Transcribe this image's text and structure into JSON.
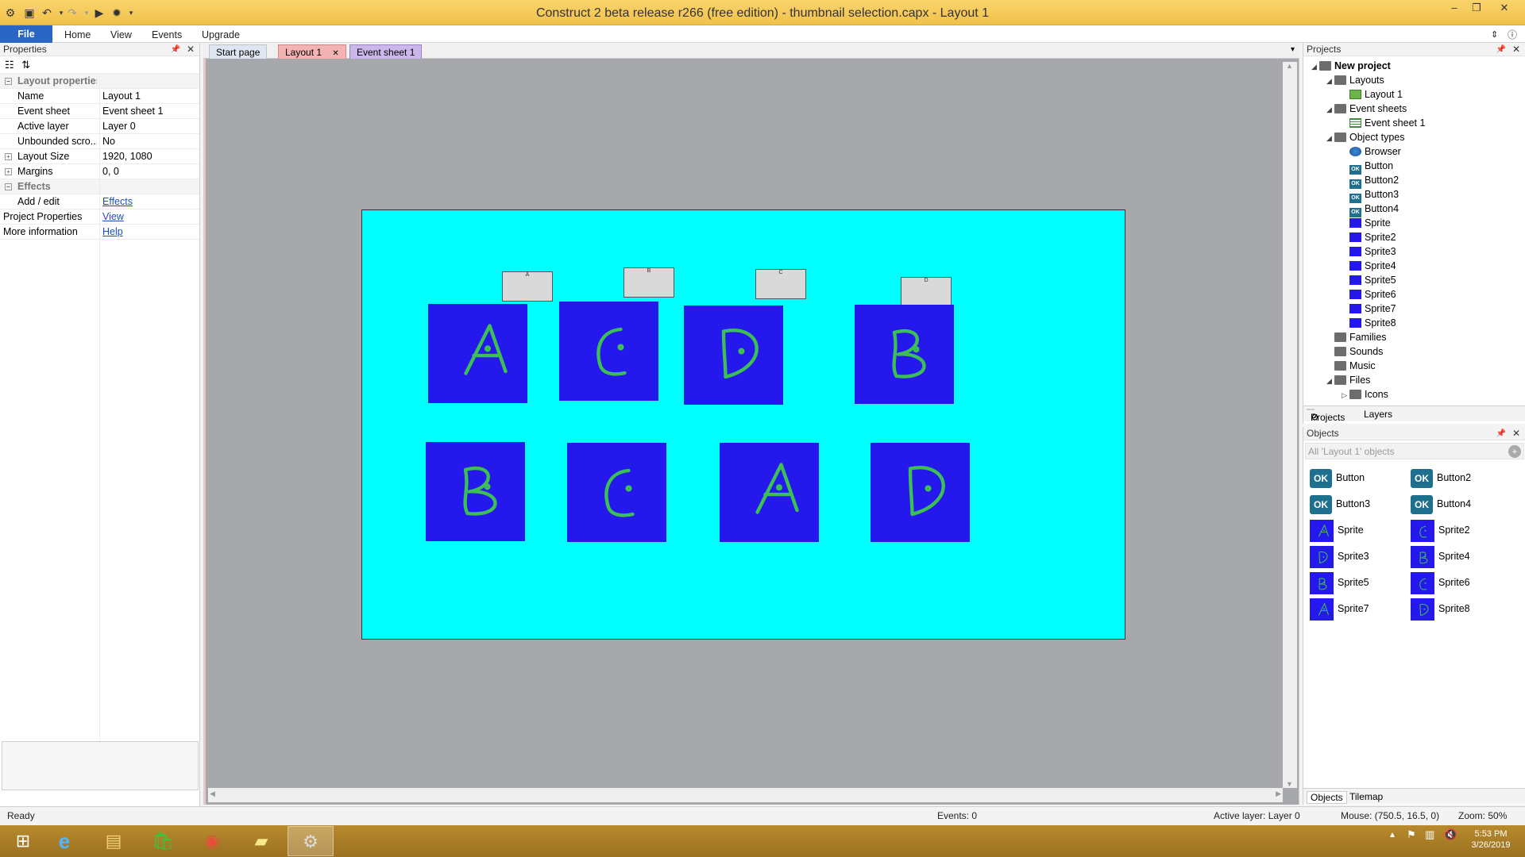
{
  "window": {
    "title": "Construct 2 beta release r266  (free edition) - thumbnail selection.capx - Layout 1"
  },
  "menu": [
    "File",
    "Home",
    "View",
    "Events",
    "Upgrade"
  ],
  "properties": {
    "header": "Properties",
    "rows": [
      {
        "type": "cat",
        "key": "Layout properties",
        "expander": "−"
      },
      {
        "key": "Name",
        "value": "Layout 1"
      },
      {
        "key": "Event sheet",
        "value": "Event sheet 1"
      },
      {
        "key": "Active layer",
        "value": "Layer 0"
      },
      {
        "key": "Unbounded scro...",
        "value": "No"
      },
      {
        "key": "Layout Size",
        "value": "1920, 1080",
        "expander": "+"
      },
      {
        "key": "Margins",
        "value": "0, 0",
        "expander": "+"
      },
      {
        "type": "cat",
        "key": "Effects",
        "expander": "−"
      },
      {
        "key": "Add / edit",
        "value": "Effects",
        "link": true
      },
      {
        "key": "Project Properties",
        "value": "View",
        "link": true,
        "flush": true
      },
      {
        "key": "More information",
        "value": "Help",
        "link": true,
        "flush": true
      }
    ]
  },
  "tabs": [
    {
      "label": "Start page"
    },
    {
      "label": "Layout 1",
      "active": true
    },
    {
      "label": "Event sheet 1"
    }
  ],
  "layout": {
    "buttons": [
      "A",
      "B",
      "C",
      "D"
    ],
    "sprites_row1": [
      "A",
      "C",
      "D",
      "B"
    ],
    "sprites_row2": [
      "B",
      "C",
      "A",
      "D"
    ]
  },
  "projects": {
    "header": "Projects",
    "tree": [
      {
        "label": "New project",
        "level": 0,
        "icon": "folder",
        "bold": true,
        "tri": "◢"
      },
      {
        "label": "Layouts",
        "level": 1,
        "icon": "folder",
        "tri": "◢"
      },
      {
        "label": "Layout 1",
        "level": 2,
        "icon": "layout"
      },
      {
        "label": "Event sheets",
        "level": 1,
        "icon": "folder",
        "tri": "◢"
      },
      {
        "label": "Event sheet 1",
        "level": 2,
        "icon": "sheet"
      },
      {
        "label": "Object types",
        "level": 1,
        "icon": "folder",
        "tri": "◢"
      },
      {
        "label": "Browser",
        "level": 2,
        "icon": "browser"
      },
      {
        "label": "Button",
        "level": 2,
        "icon": "ok"
      },
      {
        "label": "Button2",
        "level": 2,
        "icon": "ok"
      },
      {
        "label": "Button3",
        "level": 2,
        "icon": "ok"
      },
      {
        "label": "Button4",
        "level": 2,
        "icon": "ok"
      },
      {
        "label": "Sprite",
        "level": 2,
        "icon": "sprite"
      },
      {
        "label": "Sprite2",
        "level": 2,
        "icon": "sprite"
      },
      {
        "label": "Sprite3",
        "level": 2,
        "icon": "sprite"
      },
      {
        "label": "Sprite4",
        "level": 2,
        "icon": "sprite"
      },
      {
        "label": "Sprite5",
        "level": 2,
        "icon": "sprite"
      },
      {
        "label": "Sprite6",
        "level": 2,
        "icon": "sprite"
      },
      {
        "label": "Sprite7",
        "level": 2,
        "icon": "sprite"
      },
      {
        "label": "Sprite8",
        "level": 2,
        "icon": "sprite"
      },
      {
        "label": "Families",
        "level": 1,
        "icon": "folder"
      },
      {
        "label": "Sounds",
        "level": 1,
        "icon": "folder"
      },
      {
        "label": "Music",
        "level": 1,
        "icon": "folder"
      },
      {
        "label": "Files",
        "level": 1,
        "icon": "folder",
        "tri": "◢"
      },
      {
        "label": "Icons",
        "level": 2,
        "icon": "folder",
        "tri": "▷"
      }
    ],
    "subtabs": [
      "Projects",
      "Layers"
    ]
  },
  "objects": {
    "header": "Objects",
    "filter_placeholder": "All 'Layout 1' objects",
    "items": [
      {
        "label": "Button",
        "icon": "ok"
      },
      {
        "label": "Button2",
        "icon": "ok"
      },
      {
        "label": "Button3",
        "icon": "ok"
      },
      {
        "label": "Button4",
        "icon": "ok"
      },
      {
        "label": "Sprite",
        "icon": "sprite",
        "letter": "A"
      },
      {
        "label": "Sprite2",
        "icon": "sprite",
        "letter": "C"
      },
      {
        "label": "Sprite3",
        "icon": "sprite",
        "letter": "D"
      },
      {
        "label": "Sprite4",
        "icon": "sprite",
        "letter": "B"
      },
      {
        "label": "Sprite5",
        "icon": "sprite",
        "letter": "B"
      },
      {
        "label": "Sprite6",
        "icon": "sprite",
        "letter": "C"
      },
      {
        "label": "Sprite7",
        "icon": "sprite",
        "letter": "A"
      },
      {
        "label": "Sprite8",
        "icon": "sprite",
        "letter": "D"
      }
    ],
    "subtabs": [
      "Objects",
      "Tilemap"
    ]
  },
  "status": {
    "left": "Ready",
    "events": "Events: 0",
    "active_layer": "Active layer: Layer 0",
    "mouse": "Mouse: (750.5, 16.5, 0)",
    "zoom": "Zoom: 50%"
  },
  "clock": {
    "time": "5:53 PM",
    "date": "3/26/2019"
  },
  "colors": {
    "canvas_bg": "#00ffff",
    "sprite_bg": "#2418ec",
    "stroke": "#3cbf54",
    "titlebar": "#f1c14b"
  }
}
